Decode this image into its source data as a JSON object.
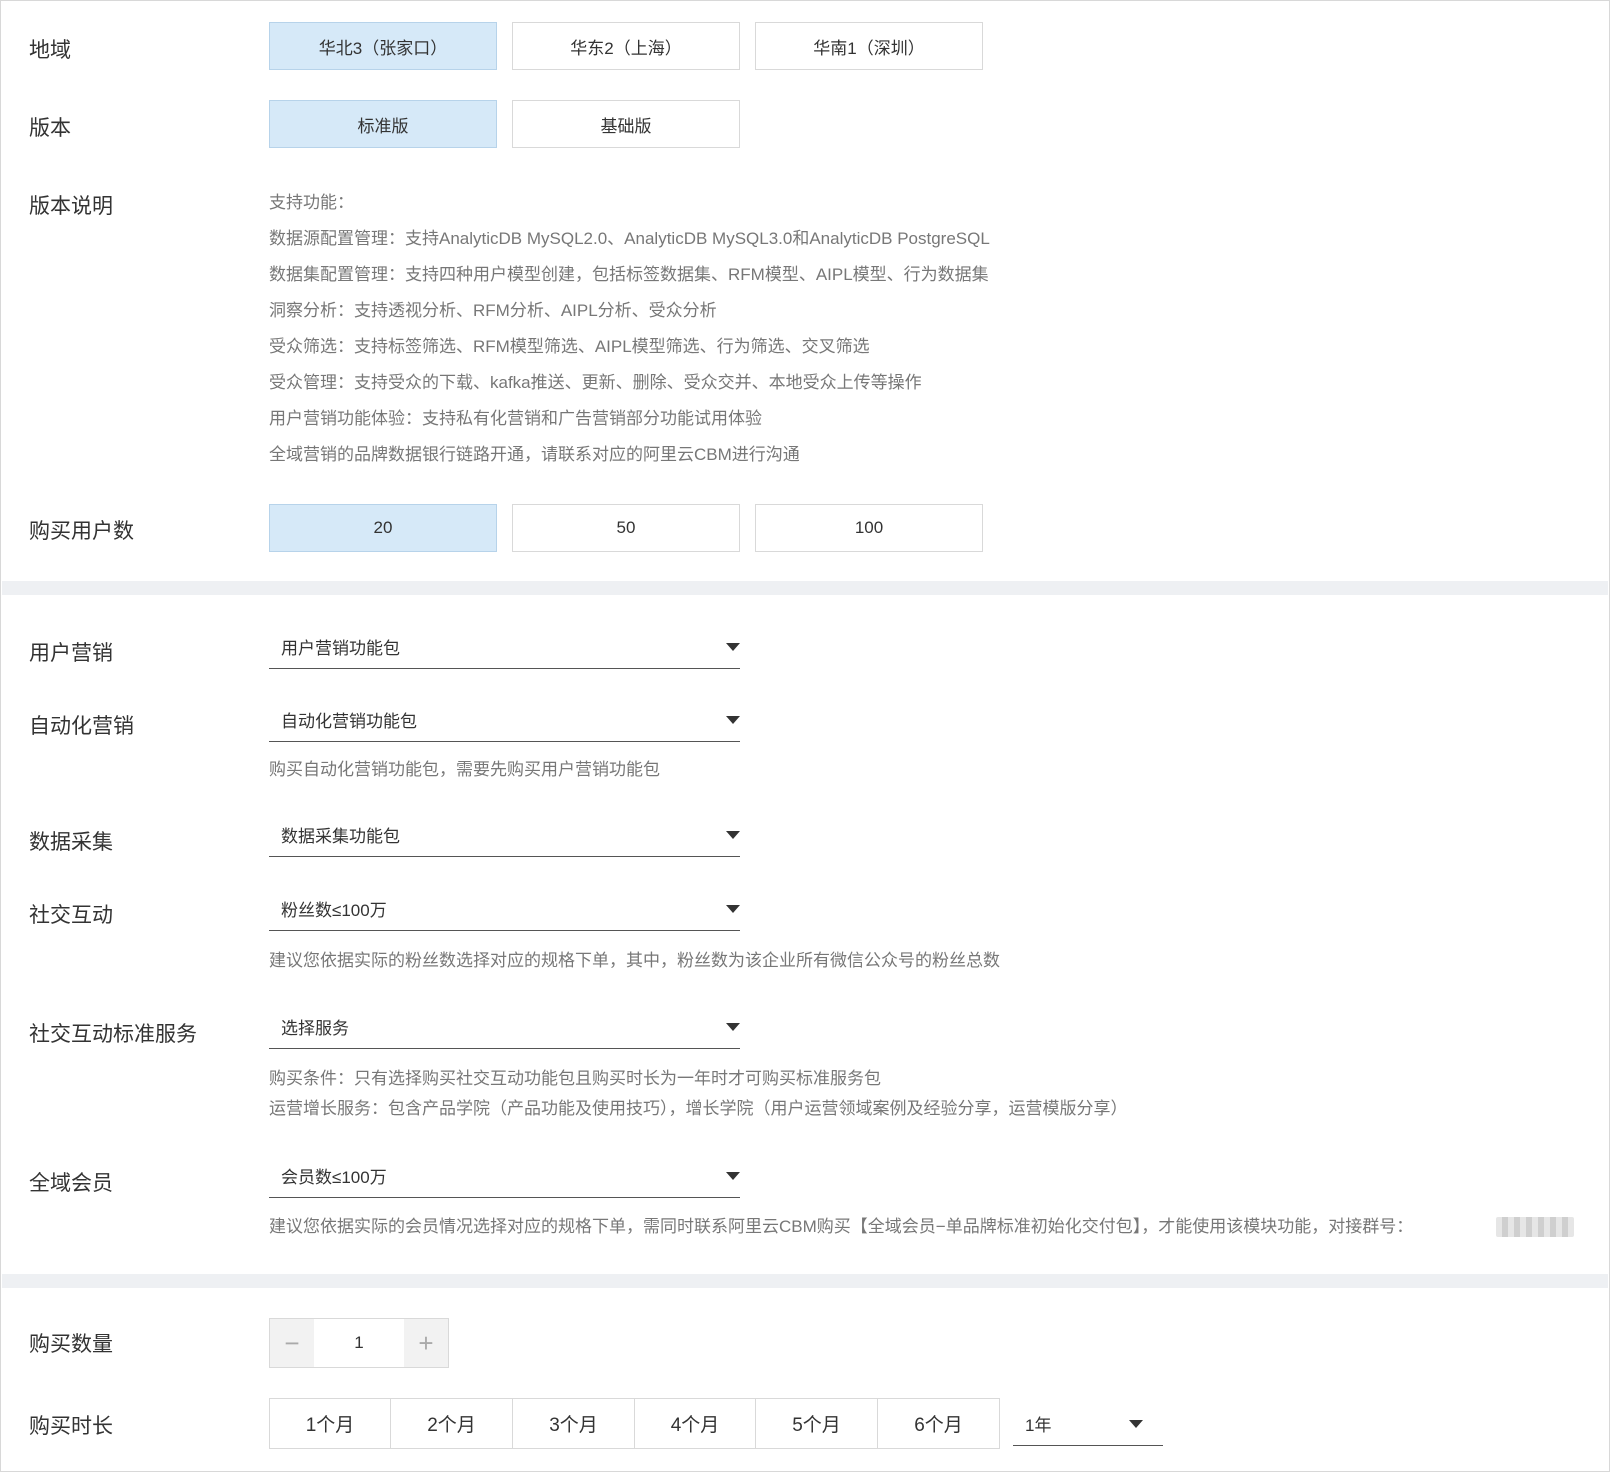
{
  "region": {
    "label": "地域",
    "options": [
      "华北3（张家口）",
      "华东2（上海）",
      "华南1（深圳）"
    ],
    "selected_index": 0
  },
  "edition": {
    "label": "版本",
    "options": [
      "标准版",
      "基础版"
    ],
    "selected_index": 0
  },
  "edition_desc": {
    "label": "版本说明",
    "lines": [
      "支持功能：",
      "数据源配置管理：支持AnalyticDB MySQL2.0、AnalyticDB MySQL3.0和AnalyticDB PostgreSQL",
      "数据集配置管理：支持四种用户模型创建，包括标签数据集、RFM模型、AIPL模型、行为数据集",
      "洞察分析：支持透视分析、RFM分析、AIPL分析、受众分析",
      "受众筛选：支持标签筛选、RFM模型筛选、AIPL模型筛选、行为筛选、交叉筛选",
      "受众管理：支持受众的下载、kafka推送、更新、删除、受众交并、本地受众上传等操作",
      "用户营销功能体验：支持私有化营销和广告营销部分功能试用体验",
      "全域营销的品牌数据银行链路开通，请联系对应的阿里云CBM进行沟通"
    ]
  },
  "users": {
    "label": "购买用户数",
    "options": [
      "20",
      "50",
      "100"
    ],
    "selected_index": 0
  },
  "addons": {
    "user_marketing": {
      "label": "用户营销",
      "value": "用户营销功能包"
    },
    "auto_marketing": {
      "label": "自动化营销",
      "value": "自动化营销功能包",
      "hint": "购买自动化营销功能包，需要先购买用户营销功能包"
    },
    "data_collection": {
      "label": "数据采集",
      "value": "数据采集功能包"
    },
    "social": {
      "label": "社交互动",
      "value": "粉丝数≤100万",
      "hint": "建议您依据实际的粉丝数选择对应的规格下单，其中，粉丝数为该企业所有微信公众号的粉丝总数"
    },
    "social_service": {
      "label": "社交互动标准服务",
      "value": "选择服务",
      "hint1": "购买条件：只有选择购买社交互动功能包且购买时长为一年时才可购买标准服务包",
      "hint2": "运营增长服务：包含产品学院（产品功能及使用技巧），增长学院（用户运营领域案例及经验分享，运营模版分享）"
    },
    "membership": {
      "label": "全域会员",
      "value": "会员数≤100万",
      "hint": "建议您依据实际的会员情况选择对应的规格下单，需同时联系阿里云CBM购买【全域会员−单品牌标准初始化交付包】，才能使用该模块功能，对接群号："
    }
  },
  "quantity": {
    "label": "购买数量",
    "value": "1",
    "minus": "−",
    "plus": "+"
  },
  "duration": {
    "label": "购买时长",
    "options": [
      "1个月",
      "2个月",
      "3个月",
      "4个月",
      "5个月",
      "6个月"
    ],
    "select_value": "1年"
  }
}
